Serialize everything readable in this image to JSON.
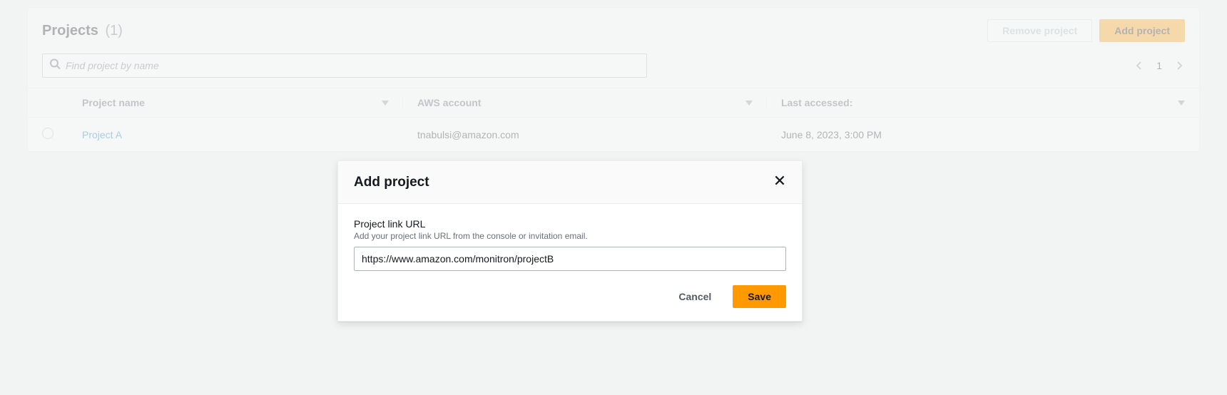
{
  "header": {
    "title": "Projects",
    "count_display": "(1)",
    "remove_label": "Remove project",
    "add_label": "Add project"
  },
  "search": {
    "placeholder": "Find project by name"
  },
  "pagination": {
    "page": "1"
  },
  "table": {
    "columns": {
      "name": "Project name",
      "account": "AWS account",
      "last": "Last accessed:"
    },
    "rows": [
      {
        "name": "Project A",
        "account": "tnabulsi@amazon.com",
        "last": "June 8, 2023, 3:00 PM"
      }
    ]
  },
  "modal": {
    "title": "Add project",
    "field_label": "Project link URL",
    "field_hint": "Add your project link URL from the console or invitation email.",
    "url_value": "https://www.amazon.com/monitron/projectB",
    "cancel_label": "Cancel",
    "save_label": "Save"
  }
}
